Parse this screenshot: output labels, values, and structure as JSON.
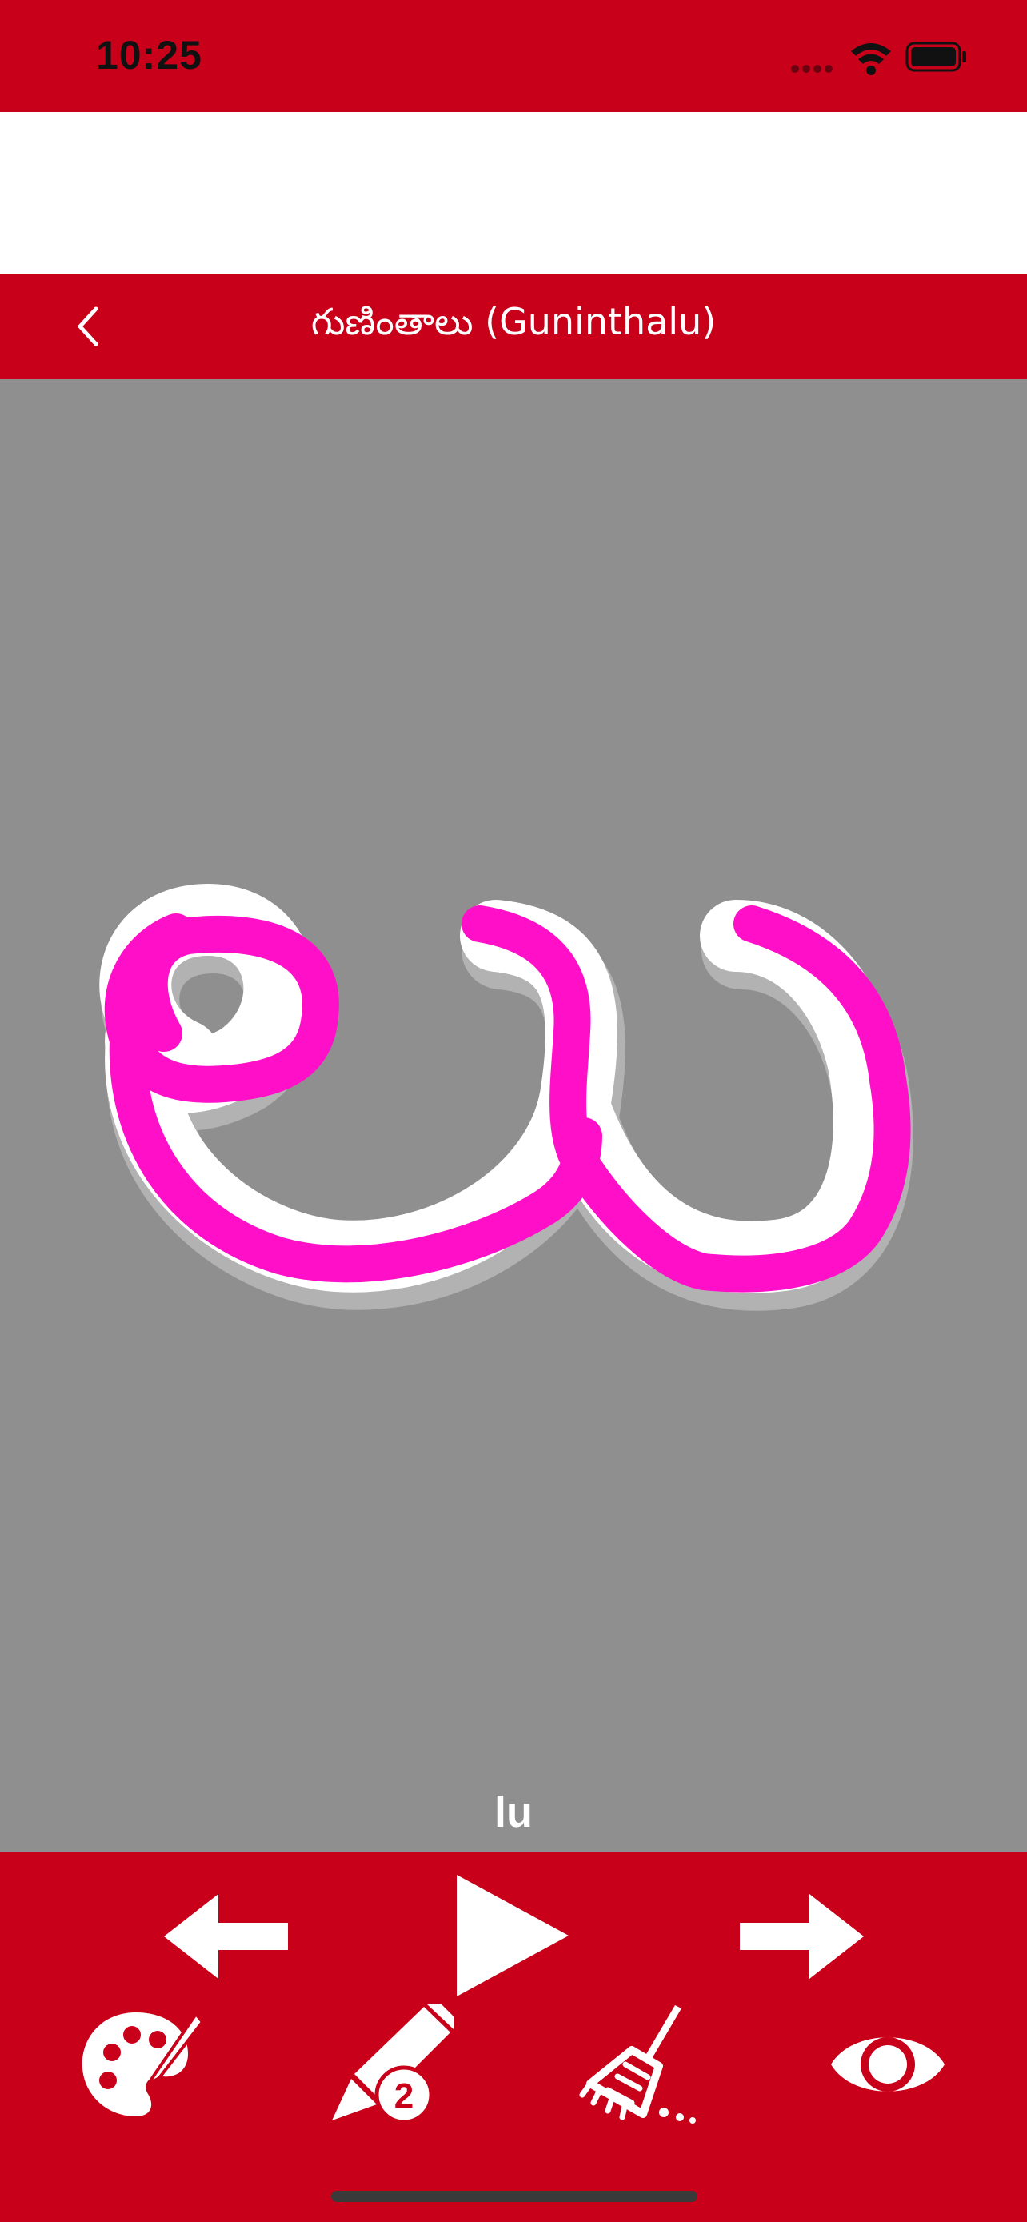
{
  "status_bar": {
    "time": "10:25"
  },
  "nav": {
    "title": "గుణింతాలు (Guninthalu)",
    "back_icon": "chevron-left-icon"
  },
  "canvas": {
    "letter_label": "lu",
    "background_color": "#8f8f8f",
    "guide_color": "#ffffff",
    "stroke_color": "#ff0fc8"
  },
  "toolbar": {
    "row1": [
      "arrow-left-icon",
      "play-icon",
      "arrow-right-icon"
    ],
    "row2": [
      "palette-icon",
      "pen-size-icon",
      "broom-icon",
      "eye-icon"
    ],
    "pen_size": "2",
    "color": "#c9001a"
  }
}
